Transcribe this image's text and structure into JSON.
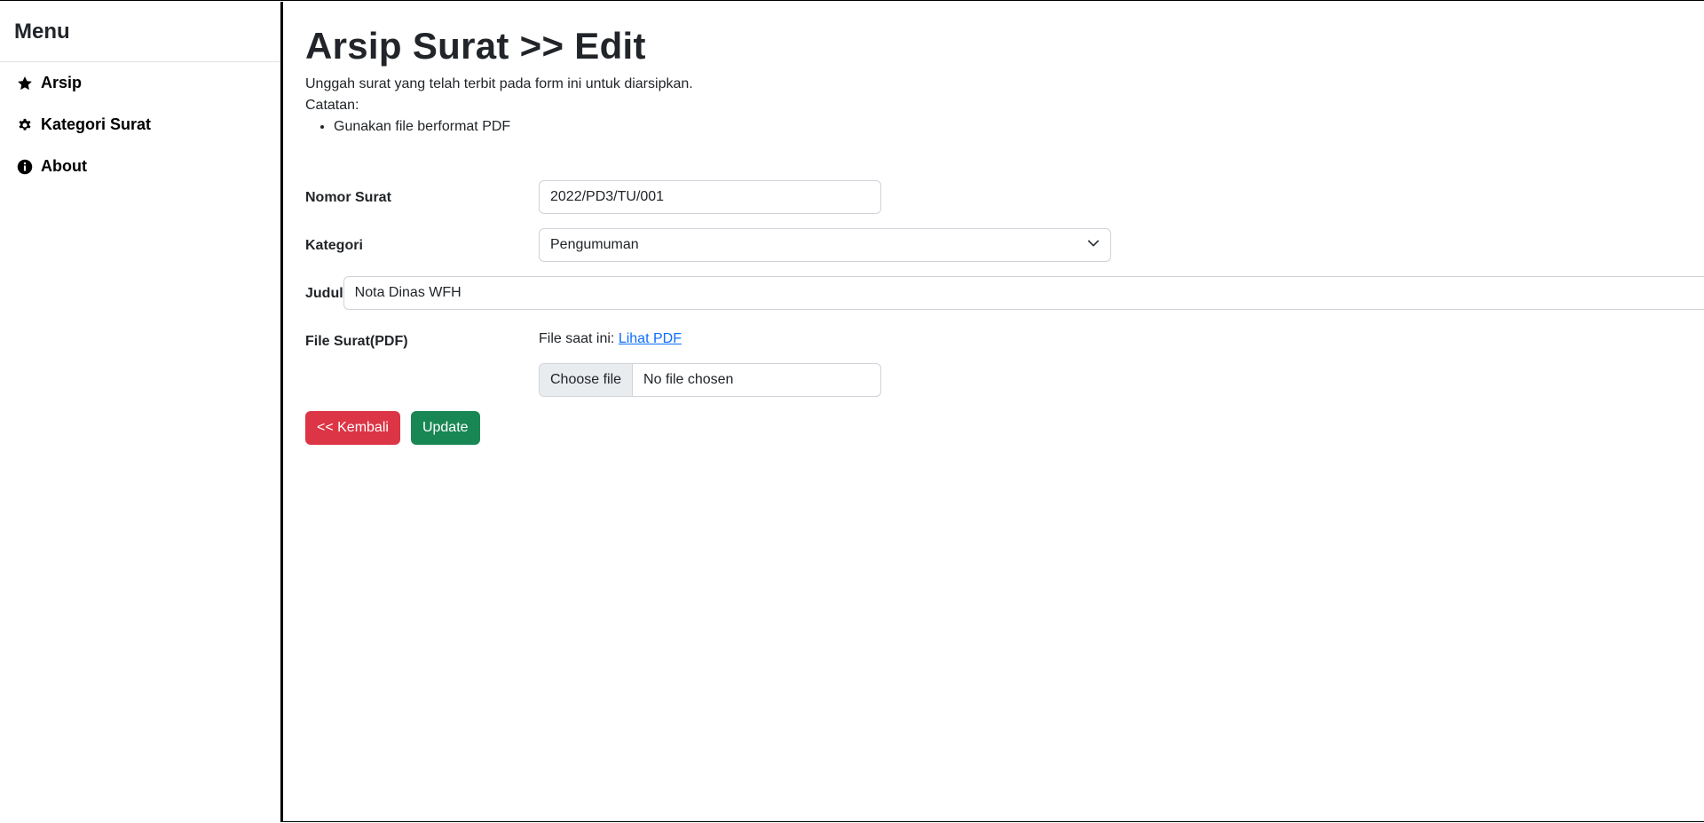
{
  "sidebar": {
    "title": "Menu",
    "items": [
      {
        "label": "Arsip",
        "icon": "star-icon"
      },
      {
        "label": "Kategori Surat",
        "icon": "gear-icon"
      },
      {
        "label": "About",
        "icon": "info-icon"
      }
    ]
  },
  "header": {
    "title": "Arsip Surat >> Edit",
    "description": "Unggah surat yang telah terbit pada form ini untuk diarsipkan.",
    "note_label": "Catatan:",
    "notes": [
      "Gunakan file berformat PDF"
    ]
  },
  "form": {
    "nomor_label": "Nomor Surat",
    "nomor_value": "2022/PD3/TU/001",
    "kategori_label": "Kategori",
    "kategori_value": "Pengumuman",
    "judul_label": "Judul",
    "judul_value": "Nota Dinas WFH",
    "file_label": "File Surat(PDF)",
    "current_file_text": "File saat ini:",
    "current_file_link": "Lihat PDF",
    "choose_file_label": "Choose file",
    "no_file_text": "No file chosen"
  },
  "buttons": {
    "back_label": "<< Kembali",
    "update_label": "Update"
  },
  "colors": {
    "danger": "#dc3545",
    "success": "#198754",
    "link": "#0d6efd"
  }
}
